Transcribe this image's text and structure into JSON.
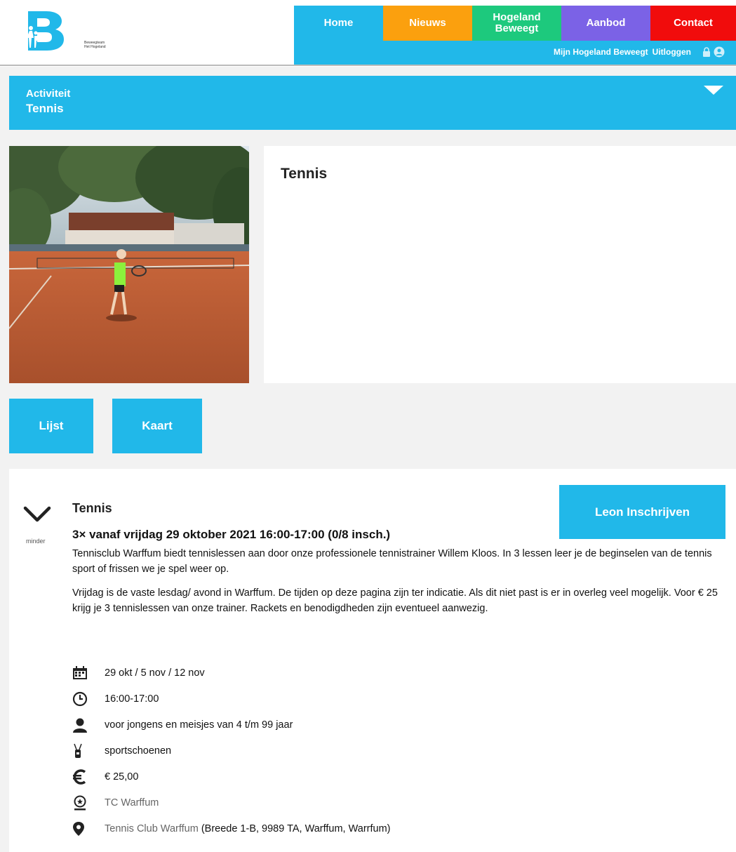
{
  "logo": {
    "letter": "B",
    "tagline_1": "Beweegteam",
    "tagline_2": "Het Hogeland"
  },
  "nav": {
    "home": "Home",
    "nieuws": "Nieuws",
    "hogeland_beweegt_1": "Hogeland",
    "hogeland_beweegt_2": "Beweegt",
    "aanbod": "Aanbod",
    "contact": "Contact",
    "mijn": "Mijn Hogeland Beweegt",
    "uitloggen": "Uitloggen"
  },
  "colors": {
    "primary": "#21b8e9",
    "nieuws": "#fba00e",
    "hogeland": "#1dc97d",
    "aanbod": "#7b62e6",
    "contact": "#f10c0c"
  },
  "activity": {
    "label": "Activiteit",
    "value": "Tennis"
  },
  "title": "Tennis",
  "view_buttons": {
    "lijst": "Lijst",
    "kaart": "Kaart"
  },
  "detail": {
    "toggle_label": "minder",
    "title": "Tennis",
    "schedule": "3× vanaf vrijdag 29 oktober 2021 16:00-17:00 (0/8 insch.)",
    "enroll_button": "Leon Inschrijven",
    "paragraph_1": "Tennisclub Warffum biedt tennislessen aan door onze professionele tennistrainer Willem Kloos. In 3 lessen leer je de beginselen van de tennis sport of frissen we je spel weer op.",
    "paragraph_2": "Vrijdag is de vaste lesdag/ avond in Warffum. De tijden op deze pagina zijn ter indicatie. Als dit niet past is er in overleg veel mogelijk. Voor € 25 krijg je 3 tennislessen van onze trainer. Rackets en benodigdheden zijn eventueel aanwezig.",
    "dates": "29 okt / 5 nov / 12 nov",
    "time": "16:00-17:00",
    "audience": "voor jongens en meisjes van 4 t/m 99 jaar",
    "requirements": "sportschoenen",
    "price": "€ 25,00",
    "organizer": "TC Warffum",
    "location_name": "Tennis Club Warffum",
    "location_address": "(Breede 1-B, 9989 TA, Warffum, Warrfum)"
  },
  "icons": [
    "calendar-icon",
    "clock-icon",
    "person-icon",
    "shoes-icon",
    "euro-icon",
    "organizer-icon",
    "location-pin-icon",
    "chevron-down-icon",
    "user-icon",
    "lock-icon"
  ]
}
